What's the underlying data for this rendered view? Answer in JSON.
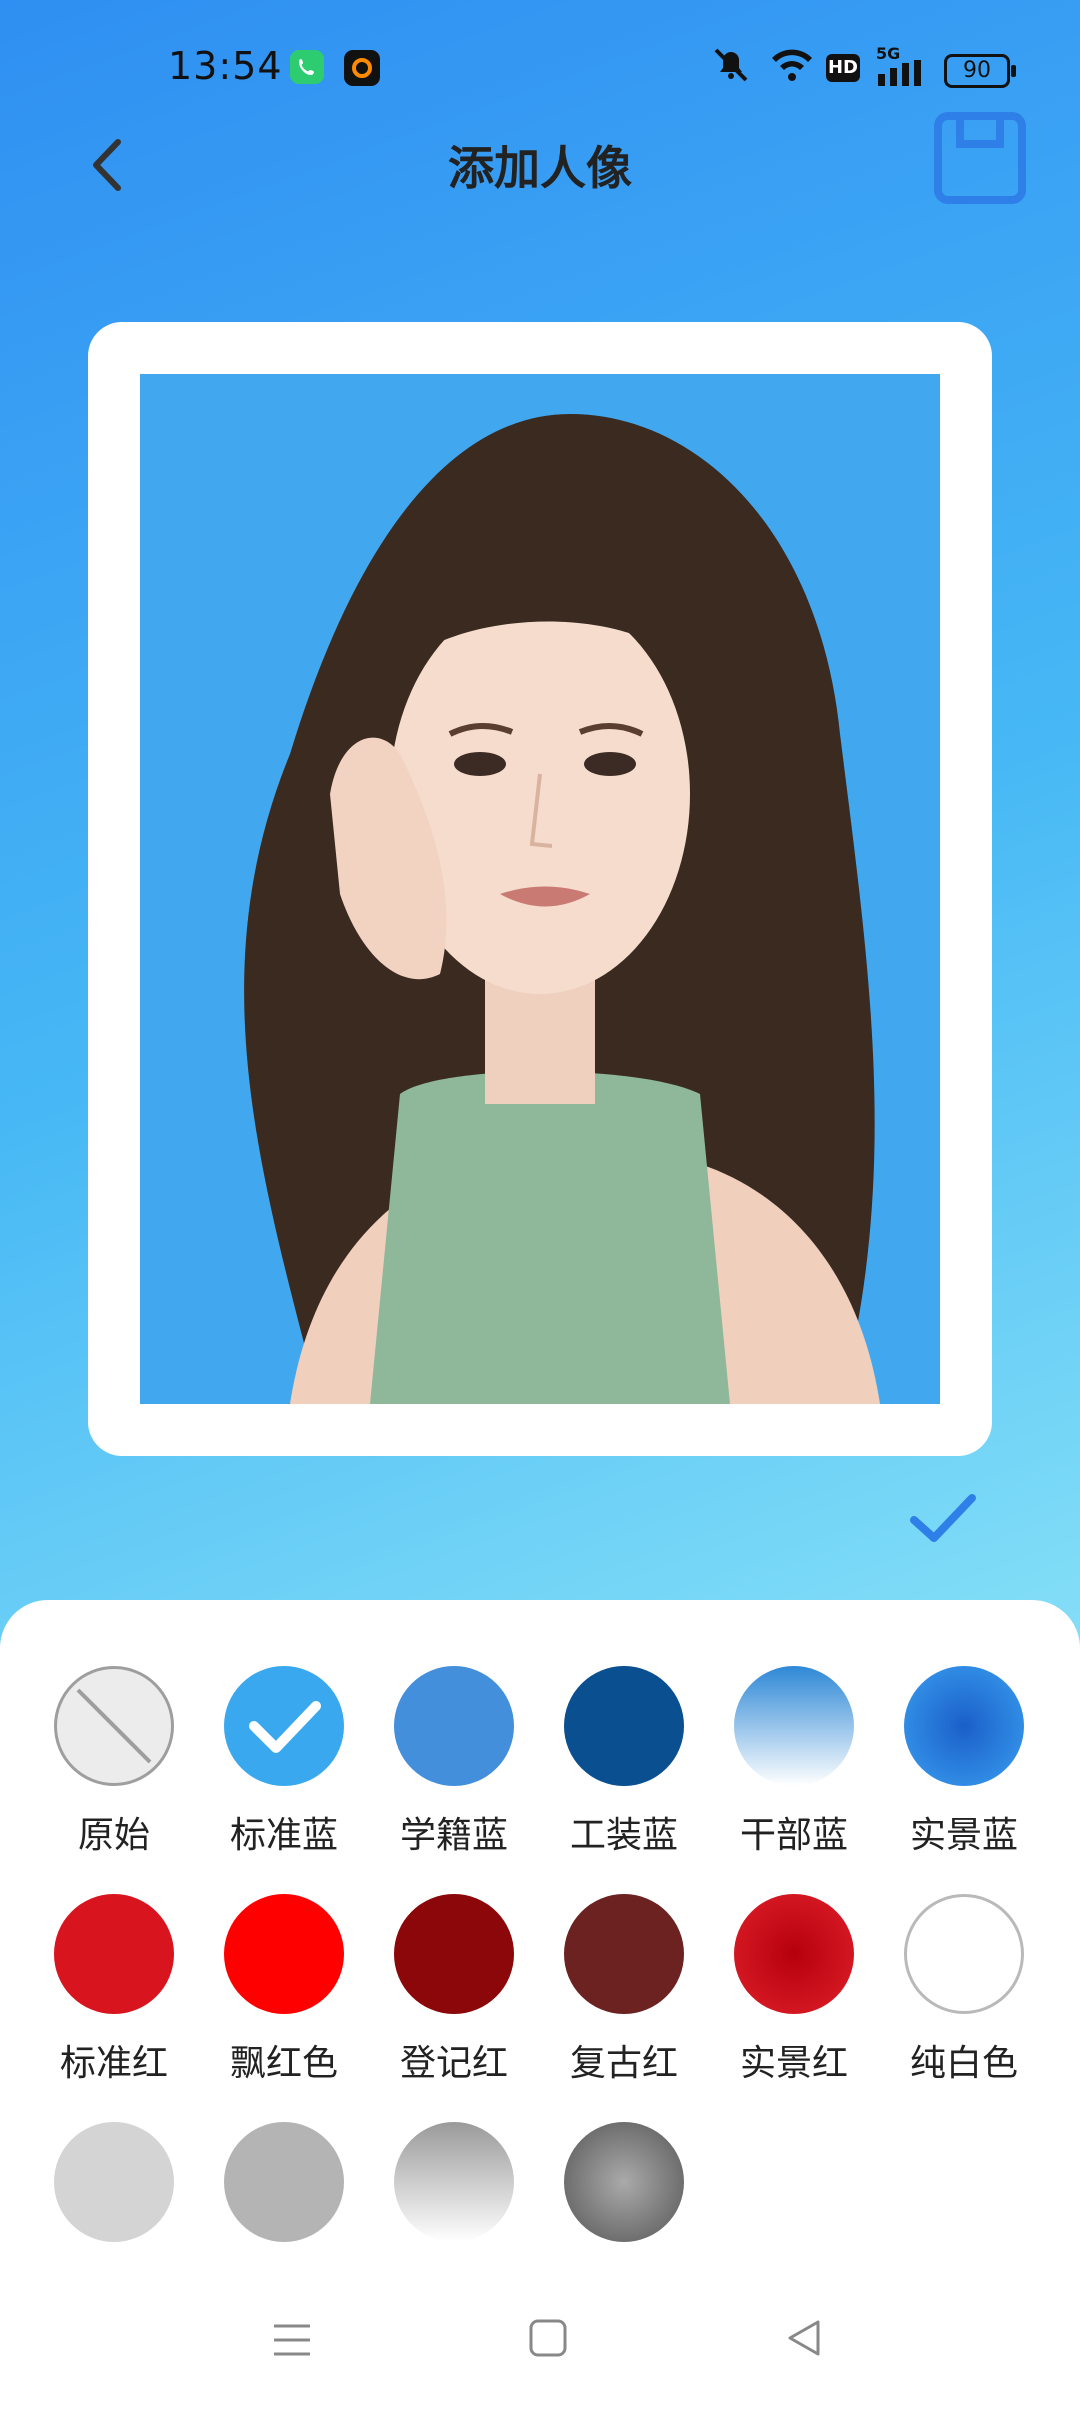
{
  "status_bar": {
    "time": "13:54",
    "network": "5G",
    "hd": "HD",
    "battery": "90"
  },
  "header": {
    "title": "添加人像"
  },
  "swatches": [
    {
      "label": "原始",
      "fill": "none",
      "selected": false
    },
    {
      "label": "标准蓝",
      "fill": "#3aa8ee",
      "selected": true
    },
    {
      "label": "学籍蓝",
      "fill": "#438fdc",
      "selected": false
    },
    {
      "label": "工装蓝",
      "fill": "#0a4f8f",
      "selected": false
    },
    {
      "label": "干部蓝",
      "fill": "gradient:#2e88d6-#ffffff",
      "selected": false
    },
    {
      "label": "实景蓝",
      "fill": "radial:#1a5fc9-#3a9ff0",
      "selected": false
    },
    {
      "label": "标准红",
      "fill": "#d8141e",
      "selected": false
    },
    {
      "label": "飘红色",
      "fill": "#ff0000",
      "selected": false
    },
    {
      "label": "登记红",
      "fill": "#8b0709",
      "selected": false
    },
    {
      "label": "复古红",
      "fill": "#6b2220",
      "selected": false
    },
    {
      "label": "实景红",
      "fill": "radial:#b5000c-#e0202a",
      "selected": false
    },
    {
      "label": "纯白色",
      "fill": "#ffffff",
      "selected": false
    },
    {
      "label": "",
      "fill": "#d4d4d4",
      "selected": false
    },
    {
      "label": "",
      "fill": "#b4b4b4",
      "selected": false
    },
    {
      "label": "",
      "fill": "gradient:#9a9a9a-#ffffff",
      "selected": false
    },
    {
      "label": "",
      "fill": "radial:#aaaaaa-#555555",
      "selected": false
    }
  ],
  "colors": {
    "accent": "#2f7fe8"
  }
}
